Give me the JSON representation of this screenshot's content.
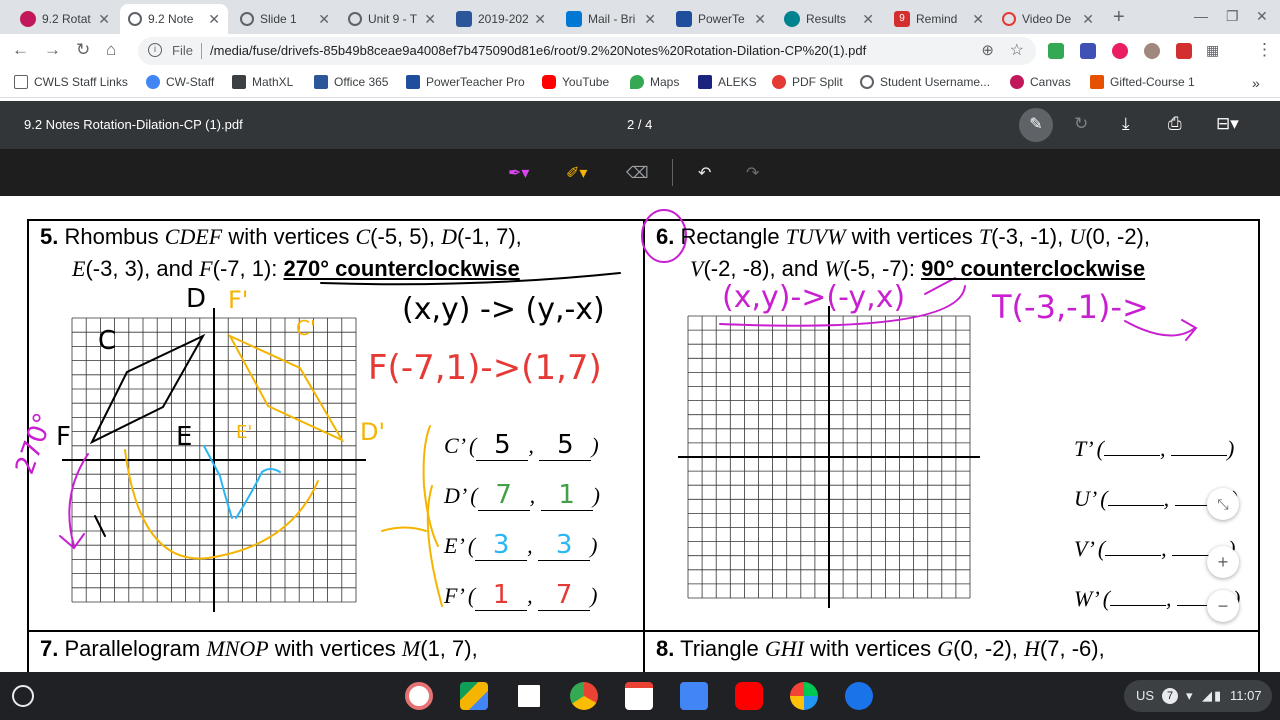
{
  "tabs": [
    {
      "label": "9.2 Rotat",
      "color": "#c2185b",
      "active": false
    },
    {
      "label": "9.2 Note",
      "color": "#5f6368",
      "active": true
    },
    {
      "label": "Slide 1",
      "color": "#5f6368",
      "active": false
    },
    {
      "label": "Unit 9 - T",
      "color": "#5f6368",
      "active": false
    },
    {
      "label": "2019-202",
      "color": "#2b579a",
      "active": false
    },
    {
      "label": "Mail - Bri",
      "color": "#0078d4",
      "active": false
    },
    {
      "label": "PowerTe",
      "color": "#1e4e9c",
      "active": false
    },
    {
      "label": "Results",
      "color": "#00838f",
      "active": false
    },
    {
      "label": "Remind",
      "color": "#d32f2f",
      "active": false
    },
    {
      "label": "Video De",
      "color": "#e53935",
      "active": false
    }
  ],
  "remind_badge": "9",
  "omnibox": {
    "scheme": "File",
    "url": "/media/fuse/drivefs-85b49b8ceae9a4008ef7b475090d81e6/root/9.2%20Notes%20Rotation-Dilation-CP%20(1).pdf"
  },
  "bookmarks": [
    {
      "label": "CWLS Staff Links",
      "color": "#5f6368"
    },
    {
      "label": "CW-Staff",
      "color": "#4285f4"
    },
    {
      "label": "MathXL",
      "color": "#3c4043"
    },
    {
      "label": "Office 365",
      "color": "#2b579a"
    },
    {
      "label": "PowerTeacher Pro",
      "color": "#1e4e9c"
    },
    {
      "label": "YouTube",
      "color": "#ff0000"
    },
    {
      "label": "Maps",
      "color": "#34a853"
    },
    {
      "label": "ALEKS",
      "color": "#1a237e"
    },
    {
      "label": "PDF Split",
      "color": "#e53935"
    },
    {
      "label": "Student Username...",
      "color": "#5f6368"
    },
    {
      "label": "Canvas",
      "color": "#c2185b"
    },
    {
      "label": "Gifted-Course 1",
      "color": "#e65100"
    }
  ],
  "bookmarks_overflow": "»",
  "pdf": {
    "title": "9.2 Notes Rotation-Dilation-CP (1).pdf",
    "page": "2 / 4"
  },
  "problem5": {
    "num": "5.",
    "line1": [
      "Rhombus ",
      "CDEF",
      " with vertices ",
      "C",
      "(-5, 5), ",
      "D",
      "(-1, 7),"
    ],
    "line2": [
      "E",
      "(-3, 3), and ",
      "F",
      "(-7, 1): ",
      "270° counterclockwise"
    ],
    "answers": [
      {
        "label": "C’ (",
        "x": "5",
        "y": "5"
      },
      {
        "label": "D’ (",
        "x": "7",
        "y": "1"
      },
      {
        "label": "E’ (",
        "x": "3",
        "y": "3"
      },
      {
        "label": "F’ (",
        "x": "1",
        "y": "7"
      }
    ],
    "handwriting": {
      "rule": "(x,y) -> (y,-x)",
      "example": "F(-7,1)->(1,7)",
      "turn": "270°",
      "graph_labels": [
        "C",
        "D",
        "E",
        "F",
        "C'",
        "D'",
        "E'",
        "F'"
      ]
    }
  },
  "problem6": {
    "num": "6.",
    "line1": [
      "Rectangle ",
      "TUVW",
      " with vertices ",
      "T",
      "(-3, -1), ",
      "U",
      "(0, -2),"
    ],
    "line2": [
      "V",
      "(-2, -8), and ",
      "W",
      "(-5, -7): ",
      "90° counterclockwise"
    ],
    "answers": [
      "T’ (",
      "U’ (",
      "V’ (",
      "W’ ("
    ],
    "handwriting": {
      "rule": "(x,y)->(-y,x)",
      "example": "T(-3,-1)->"
    }
  },
  "problem7": {
    "num": "7.",
    "text": [
      "Parallelogram ",
      "MNOP",
      " with vertices ",
      "M",
      "(1, 7),"
    ]
  },
  "problem8": {
    "num": "8.",
    "text": [
      "Triangle ",
      "GHI",
      " with vertices ",
      "G",
      "(0, -2), ",
      "H",
      "(7, -6),"
    ]
  },
  "tray": {
    "locale": "US",
    "notifications": "7",
    "time": "11:07"
  },
  "colors": {
    "pdf_toolbar": "#323639",
    "ink_black": "#000000",
    "ink_red": "#e53935",
    "ink_yellow": "#f4b400",
    "ink_green": "#43a047",
    "ink_blue": "#29b6f6",
    "ink_magenta": "#c81fd0"
  }
}
